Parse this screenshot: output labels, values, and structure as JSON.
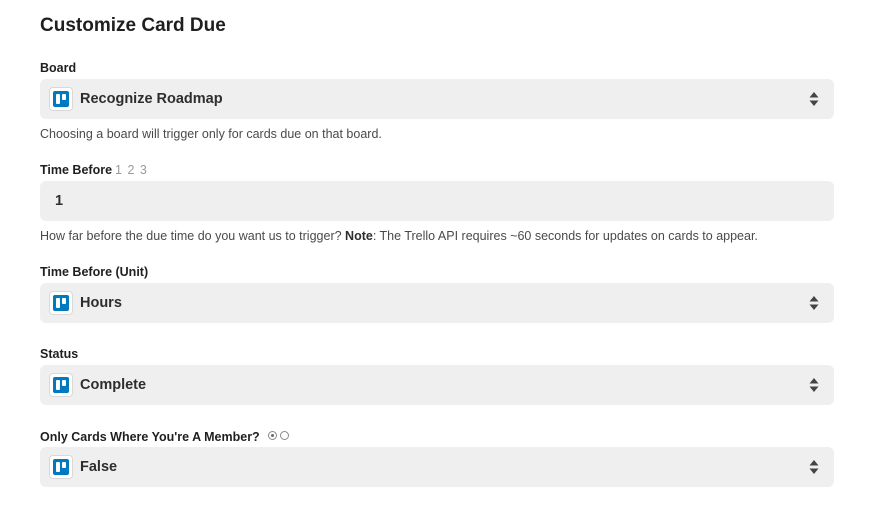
{
  "page": {
    "title": "Customize Card Due"
  },
  "board_field": {
    "label": "Board",
    "value": "Recognize Roadmap",
    "help": "Choosing a board will trigger only for cards due on that board.",
    "icon": "trello-icon"
  },
  "time_before_field": {
    "label": "Time Before",
    "label_numbers": "1 2 3",
    "value": "1",
    "help_prefix": "How far before the due time do you want us to trigger?",
    "help_note_label": "Note",
    "help_note_text": ": The Trello API requires ~60 seconds for updates on cards to appear."
  },
  "time_unit_field": {
    "label": "Time Before (Unit)",
    "value": "Hours",
    "icon": "trello-icon"
  },
  "status_field": {
    "label": "Status",
    "value": "Complete",
    "icon": "trello-icon"
  },
  "member_field": {
    "label": "Only Cards Where You're A Member?",
    "value": "False",
    "icon": "trello-icon",
    "radio_selected_index": 0
  },
  "colors": {
    "field_background": "#efefef",
    "trello_blue": "#0079bf",
    "text_primary": "#1f1f1f",
    "text_help": "#4a4a4a"
  }
}
